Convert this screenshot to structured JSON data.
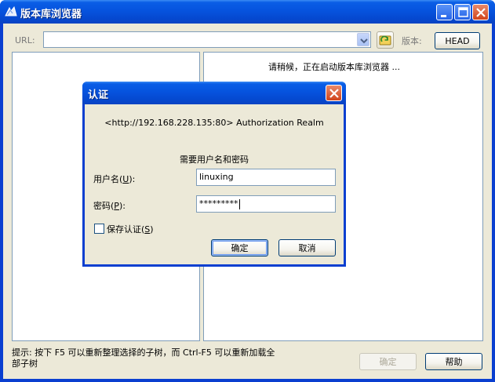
{
  "window": {
    "title": "版本库浏览器",
    "url_label": "URL:",
    "url_value": "",
    "revision_label": "版本:",
    "revision_button": "HEAD"
  },
  "right_pane": {
    "status": "请稍候，正在启动版本库浏览器 ..."
  },
  "footer": {
    "hint": "提示: 按下 F5 可以重新整理选择的子树，而 Ctrl-F5 可以重新加载全部子树",
    "ok_label": "确定",
    "help_label": "帮助"
  },
  "dialog": {
    "title": "认证",
    "realm": "<http://192.168.228.135:80> Authorization Realm",
    "prompt": "需要用户名和密码",
    "username_label_pre": "用户名(",
    "username_label_key": "U",
    "username_label_post": "):",
    "username_value": "linuxing",
    "password_label_pre": "密码(",
    "password_label_key": "P",
    "password_label_post": "):",
    "password_value": "*********",
    "save_label_pre": "保存认证(",
    "save_label_key": "S",
    "save_label_post": ")",
    "save_checked": false,
    "ok_label": "确定",
    "cancel_label": "取消"
  },
  "icons": {
    "app": "repo-browser-icon",
    "go": "folder-refresh-icon",
    "minimize": "minimize-icon",
    "maximize": "maximize-icon",
    "close": "close-icon"
  }
}
